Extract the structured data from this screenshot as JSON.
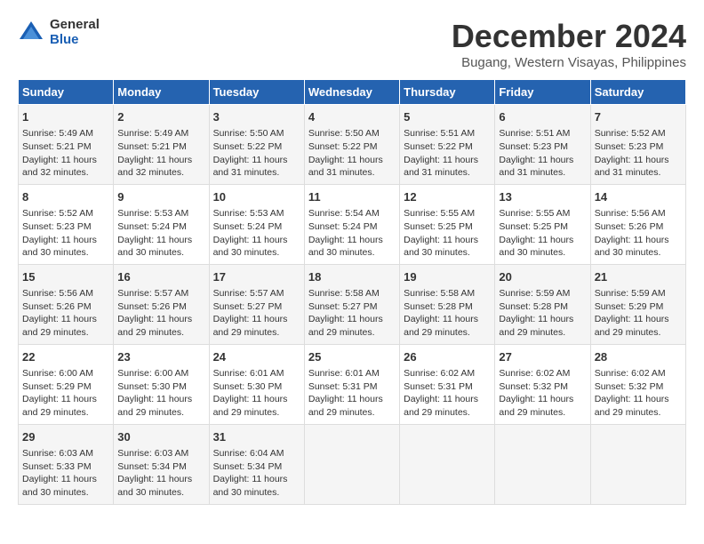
{
  "header": {
    "logo_general": "General",
    "logo_blue": "Blue",
    "title": "December 2024",
    "subtitle": "Bugang, Western Visayas, Philippines"
  },
  "calendar": {
    "headers": [
      "Sunday",
      "Monday",
      "Tuesday",
      "Wednesday",
      "Thursday",
      "Friday",
      "Saturday"
    ],
    "weeks": [
      [
        {
          "day": "",
          "text": ""
        },
        {
          "day": "",
          "text": ""
        },
        {
          "day": "",
          "text": ""
        },
        {
          "day": "",
          "text": ""
        },
        {
          "day": "",
          "text": ""
        },
        {
          "day": "",
          "text": ""
        },
        {
          "day": "",
          "text": ""
        }
      ]
    ],
    "rows": [
      [
        {
          "day": "1",
          "lines": [
            "Sunrise: 5:49 AM",
            "Sunset: 5:21 PM",
            "Daylight: 11 hours",
            "and 32 minutes."
          ]
        },
        {
          "day": "2",
          "lines": [
            "Sunrise: 5:49 AM",
            "Sunset: 5:21 PM",
            "Daylight: 11 hours",
            "and 32 minutes."
          ]
        },
        {
          "day": "3",
          "lines": [
            "Sunrise: 5:50 AM",
            "Sunset: 5:22 PM",
            "Daylight: 11 hours",
            "and 31 minutes."
          ]
        },
        {
          "day": "4",
          "lines": [
            "Sunrise: 5:50 AM",
            "Sunset: 5:22 PM",
            "Daylight: 11 hours",
            "and 31 minutes."
          ]
        },
        {
          "day": "5",
          "lines": [
            "Sunrise: 5:51 AM",
            "Sunset: 5:22 PM",
            "Daylight: 11 hours",
            "and 31 minutes."
          ]
        },
        {
          "day": "6",
          "lines": [
            "Sunrise: 5:51 AM",
            "Sunset: 5:23 PM",
            "Daylight: 11 hours",
            "and 31 minutes."
          ]
        },
        {
          "day": "7",
          "lines": [
            "Sunrise: 5:52 AM",
            "Sunset: 5:23 PM",
            "Daylight: 11 hours",
            "and 31 minutes."
          ]
        }
      ],
      [
        {
          "day": "8",
          "lines": [
            "Sunrise: 5:52 AM",
            "Sunset: 5:23 PM",
            "Daylight: 11 hours",
            "and 30 minutes."
          ]
        },
        {
          "day": "9",
          "lines": [
            "Sunrise: 5:53 AM",
            "Sunset: 5:24 PM",
            "Daylight: 11 hours",
            "and 30 minutes."
          ]
        },
        {
          "day": "10",
          "lines": [
            "Sunrise: 5:53 AM",
            "Sunset: 5:24 PM",
            "Daylight: 11 hours",
            "and 30 minutes."
          ]
        },
        {
          "day": "11",
          "lines": [
            "Sunrise: 5:54 AM",
            "Sunset: 5:24 PM",
            "Daylight: 11 hours",
            "and 30 minutes."
          ]
        },
        {
          "day": "12",
          "lines": [
            "Sunrise: 5:55 AM",
            "Sunset: 5:25 PM",
            "Daylight: 11 hours",
            "and 30 minutes."
          ]
        },
        {
          "day": "13",
          "lines": [
            "Sunrise: 5:55 AM",
            "Sunset: 5:25 PM",
            "Daylight: 11 hours",
            "and 30 minutes."
          ]
        },
        {
          "day": "14",
          "lines": [
            "Sunrise: 5:56 AM",
            "Sunset: 5:26 PM",
            "Daylight: 11 hours",
            "and 30 minutes."
          ]
        }
      ],
      [
        {
          "day": "15",
          "lines": [
            "Sunrise: 5:56 AM",
            "Sunset: 5:26 PM",
            "Daylight: 11 hours",
            "and 29 minutes."
          ]
        },
        {
          "day": "16",
          "lines": [
            "Sunrise: 5:57 AM",
            "Sunset: 5:26 PM",
            "Daylight: 11 hours",
            "and 29 minutes."
          ]
        },
        {
          "day": "17",
          "lines": [
            "Sunrise: 5:57 AM",
            "Sunset: 5:27 PM",
            "Daylight: 11 hours",
            "and 29 minutes."
          ]
        },
        {
          "day": "18",
          "lines": [
            "Sunrise: 5:58 AM",
            "Sunset: 5:27 PM",
            "Daylight: 11 hours",
            "and 29 minutes."
          ]
        },
        {
          "day": "19",
          "lines": [
            "Sunrise: 5:58 AM",
            "Sunset: 5:28 PM",
            "Daylight: 11 hours",
            "and 29 minutes."
          ]
        },
        {
          "day": "20",
          "lines": [
            "Sunrise: 5:59 AM",
            "Sunset: 5:28 PM",
            "Daylight: 11 hours",
            "and 29 minutes."
          ]
        },
        {
          "day": "21",
          "lines": [
            "Sunrise: 5:59 AM",
            "Sunset: 5:29 PM",
            "Daylight: 11 hours",
            "and 29 minutes."
          ]
        }
      ],
      [
        {
          "day": "22",
          "lines": [
            "Sunrise: 6:00 AM",
            "Sunset: 5:29 PM",
            "Daylight: 11 hours",
            "and 29 minutes."
          ]
        },
        {
          "day": "23",
          "lines": [
            "Sunrise: 6:00 AM",
            "Sunset: 5:30 PM",
            "Daylight: 11 hours",
            "and 29 minutes."
          ]
        },
        {
          "day": "24",
          "lines": [
            "Sunrise: 6:01 AM",
            "Sunset: 5:30 PM",
            "Daylight: 11 hours",
            "and 29 minutes."
          ]
        },
        {
          "day": "25",
          "lines": [
            "Sunrise: 6:01 AM",
            "Sunset: 5:31 PM",
            "Daylight: 11 hours",
            "and 29 minutes."
          ]
        },
        {
          "day": "26",
          "lines": [
            "Sunrise: 6:02 AM",
            "Sunset: 5:31 PM",
            "Daylight: 11 hours",
            "and 29 minutes."
          ]
        },
        {
          "day": "27",
          "lines": [
            "Sunrise: 6:02 AM",
            "Sunset: 5:32 PM",
            "Daylight: 11 hours",
            "and 29 minutes."
          ]
        },
        {
          "day": "28",
          "lines": [
            "Sunrise: 6:02 AM",
            "Sunset: 5:32 PM",
            "Daylight: 11 hours",
            "and 29 minutes."
          ]
        }
      ],
      [
        {
          "day": "29",
          "lines": [
            "Sunrise: 6:03 AM",
            "Sunset: 5:33 PM",
            "Daylight: 11 hours",
            "and 30 minutes."
          ]
        },
        {
          "day": "30",
          "lines": [
            "Sunrise: 6:03 AM",
            "Sunset: 5:34 PM",
            "Daylight: 11 hours",
            "and 30 minutes."
          ]
        },
        {
          "day": "31",
          "lines": [
            "Sunrise: 6:04 AM",
            "Sunset: 5:34 PM",
            "Daylight: 11 hours",
            "and 30 minutes."
          ]
        },
        {
          "day": "",
          "lines": []
        },
        {
          "day": "",
          "lines": []
        },
        {
          "day": "",
          "lines": []
        },
        {
          "day": "",
          "lines": []
        }
      ]
    ]
  }
}
